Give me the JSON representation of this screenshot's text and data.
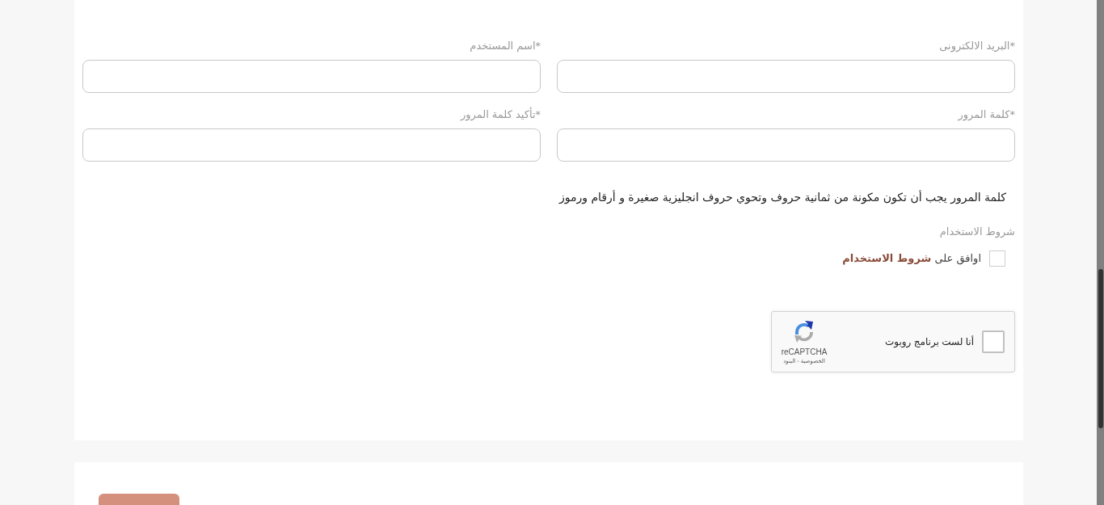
{
  "fields": [
    {
      "label": "*البريد الالكترونى"
    },
    {
      "label": "*اسم المستخدم"
    },
    {
      "label": "*كلمة المرور"
    },
    {
      "label": "*تأكيد كلمة المرور"
    }
  ],
  "password_hint": "كلمة المرور يجب أن تكون مكونة من ثمانية حروف وتحوي حروف انجليزية صغيرة و أرقام ورموز",
  "terms": {
    "heading": "شروط الاستخدام",
    "agree": {
      "checked": false,
      "label": "اوافق على",
      "link": "شروط الاستخدام"
    }
  },
  "captcha": {
    "checked": false,
    "label": "أنا لست برنامج روبوت",
    "brand": "reCAPTCHA",
    "privacy_link": "الخصوصية",
    "separator": "-",
    "terms_link": "البنود"
  }
}
